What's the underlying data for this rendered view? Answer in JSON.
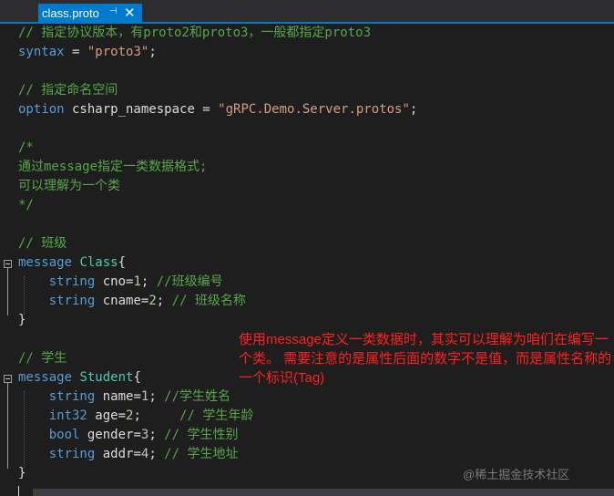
{
  "tab": {
    "label": "class.proto",
    "pin_icon": "pin-icon",
    "close_icon": "close-icon"
  },
  "code": [
    [
      {
        "t": "// 指定协议版本，有proto2和proto3，一般都指定proto3",
        "c": "comment"
      }
    ],
    [
      {
        "t": "syntax",
        "c": "kw"
      },
      {
        "t": " = ",
        "c": "plain"
      },
      {
        "t": "\"proto3\"",
        "c": "str"
      },
      {
        "t": ";",
        "c": "plain"
      }
    ],
    [],
    [
      {
        "t": "// 指定命名空间",
        "c": "comment"
      }
    ],
    [
      {
        "t": "option",
        "c": "kw"
      },
      {
        "t": " csharp_namespace = ",
        "c": "plain"
      },
      {
        "t": "\"gRPC.Demo.Server.protos\"",
        "c": "str"
      },
      {
        "t": ";",
        "c": "plain"
      }
    ],
    [],
    [
      {
        "t": "/*",
        "c": "comment"
      }
    ],
    [
      {
        "t": "通过message指定一类数据格式;",
        "c": "comment"
      }
    ],
    [
      {
        "t": "可以理解为一个类",
        "c": "comment"
      }
    ],
    [
      {
        "t": "*/",
        "c": "comment"
      }
    ],
    [],
    [
      {
        "t": "// 班级",
        "c": "comment"
      }
    ],
    [
      {
        "t": "message",
        "c": "kw"
      },
      {
        "t": " ",
        "c": "plain"
      },
      {
        "t": "Class",
        "c": "type"
      },
      {
        "t": "{",
        "c": "plain"
      }
    ],
    [
      {
        "t": "    ",
        "c": "plain"
      },
      {
        "t": "string",
        "c": "kw"
      },
      {
        "t": " cno=",
        "c": "plain"
      },
      {
        "t": "1",
        "c": "num"
      },
      {
        "t": "; ",
        "c": "plain"
      },
      {
        "t": "//班级编号",
        "c": "comment"
      }
    ],
    [
      {
        "t": "    ",
        "c": "plain"
      },
      {
        "t": "string",
        "c": "kw"
      },
      {
        "t": " cname=",
        "c": "plain"
      },
      {
        "t": "2",
        "c": "num"
      },
      {
        "t": "; ",
        "c": "plain"
      },
      {
        "t": "// 班级名称",
        "c": "comment"
      }
    ],
    [
      {
        "t": "}",
        "c": "plain"
      }
    ],
    [],
    [
      {
        "t": "// 学生",
        "c": "comment"
      }
    ],
    [
      {
        "t": "message",
        "c": "kw"
      },
      {
        "t": " ",
        "c": "plain"
      },
      {
        "t": "Student",
        "c": "type"
      },
      {
        "t": "{",
        "c": "plain"
      }
    ],
    [
      {
        "t": "    ",
        "c": "plain"
      },
      {
        "t": "string",
        "c": "kw"
      },
      {
        "t": " name=",
        "c": "plain"
      },
      {
        "t": "1",
        "c": "num"
      },
      {
        "t": "; ",
        "c": "plain"
      },
      {
        "t": "//学生姓名",
        "c": "comment"
      }
    ],
    [
      {
        "t": "    ",
        "c": "plain"
      },
      {
        "t": "int32",
        "c": "kw"
      },
      {
        "t": " age=",
        "c": "plain"
      },
      {
        "t": "2",
        "c": "num"
      },
      {
        "t": ";     ",
        "c": "plain"
      },
      {
        "t": "// 学生年龄",
        "c": "comment"
      }
    ],
    [
      {
        "t": "    ",
        "c": "plain"
      },
      {
        "t": "bool",
        "c": "kw"
      },
      {
        "t": " gender=",
        "c": "plain"
      },
      {
        "t": "3",
        "c": "num"
      },
      {
        "t": "; ",
        "c": "plain"
      },
      {
        "t": "// 学生性别",
        "c": "comment"
      }
    ],
    [
      {
        "t": "    ",
        "c": "plain"
      },
      {
        "t": "string",
        "c": "kw"
      },
      {
        "t": " addr=",
        "c": "plain"
      },
      {
        "t": "4",
        "c": "num"
      },
      {
        "t": "; ",
        "c": "plain"
      },
      {
        "t": "// 学生地址",
        "c": "comment"
      }
    ],
    [
      {
        "t": "}",
        "c": "plain"
      }
    ]
  ],
  "annotation": "使用message定义一类数据时，其实可以理解为咱们在编写一个类。 需要注意的是属性后面的数字不是值，而是属性名称的一个标识(Tag)",
  "watermark": "@稀土掘金技术社区",
  "colors": {
    "background": "#1e1e1e",
    "tab_accent": "#007acc",
    "comment": "#57a64a",
    "keyword": "#569cd6",
    "type": "#4ec9b0",
    "string": "#d69d85",
    "number": "#b5cea8",
    "annotation": "#ff2020"
  }
}
